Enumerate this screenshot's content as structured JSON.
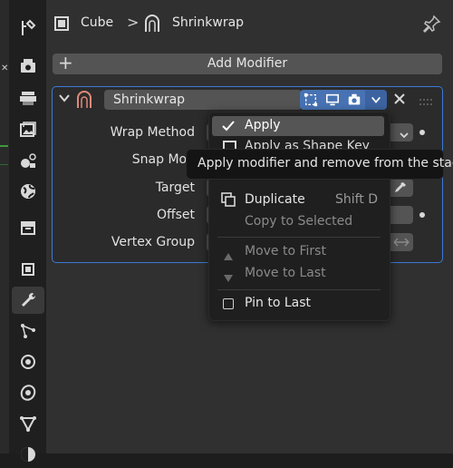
{
  "breadcrumb": {
    "object": "Cube",
    "separator": ">",
    "modifier": "Shrinkwrap"
  },
  "toolbar": {
    "add_modifier_label": "Add Modifier",
    "add_icon": "+"
  },
  "modifier": {
    "name": "Shrinkwrap",
    "properties": [
      {
        "label": "Wrap Method"
      },
      {
        "label": "Snap Mod"
      },
      {
        "label": "Target"
      },
      {
        "label": "Offset"
      },
      {
        "label": "Vertex Group"
      }
    ]
  },
  "dropdown": {
    "items": [
      {
        "label": "Apply",
        "icon": "check-icon",
        "highlighted": true
      },
      {
        "label": "Apply as Shape Key",
        "icon": "shape-key-icon"
      },
      {
        "label": "Duplicate",
        "shortcut": "Shift D",
        "icon": "duplicate-icon"
      },
      {
        "label": "Copy to Selected",
        "disabled": true
      },
      {
        "label": "Move to First",
        "disabled": true,
        "icon": "triangle-up-icon"
      },
      {
        "label": "Move to Last",
        "disabled": true,
        "icon": "triangle-down-icon"
      },
      {
        "label": "Pin to Last",
        "icon": "checkbox-icon"
      }
    ]
  },
  "tooltip": {
    "text": "Apply modifier and remove from the stack."
  },
  "colors": {
    "accent": "#4772b3",
    "panel_border": "#3d7ad6",
    "background": "#303030",
    "menu_bg": "#1f1f1f"
  }
}
